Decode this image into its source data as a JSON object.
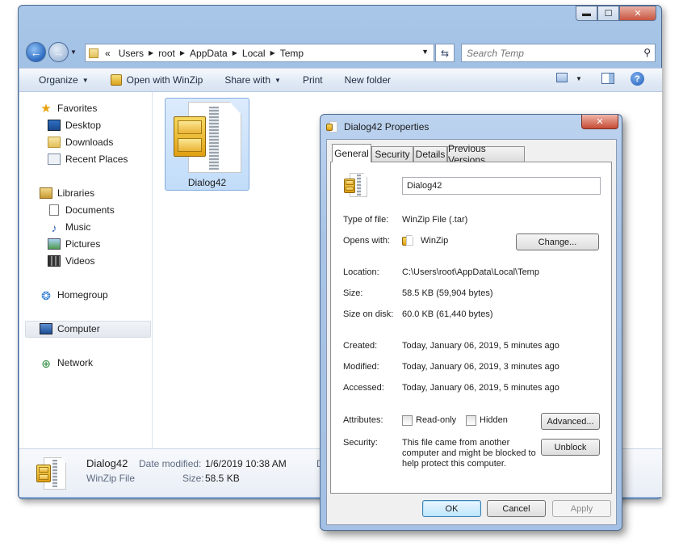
{
  "explorer": {
    "breadcrumb": {
      "overflow": "«",
      "parts": [
        "Users",
        "root",
        "AppData",
        "Local",
        "Temp"
      ]
    },
    "search_placeholder": "Search Temp",
    "toolbar": {
      "organize": "Organize",
      "open_with": "Open with WinZip",
      "share_with": "Share with",
      "print": "Print",
      "new_folder": "New folder"
    },
    "nav": {
      "favorites": "Favorites",
      "desktop": "Desktop",
      "downloads": "Downloads",
      "recent_places": "Recent Places",
      "libraries": "Libraries",
      "documents": "Documents",
      "music": "Music",
      "pictures": "Pictures",
      "videos": "Videos",
      "homegroup": "Homegroup",
      "computer": "Computer",
      "network": "Network"
    },
    "file": {
      "name": "Dialog42"
    },
    "details": {
      "name": "Dialog42",
      "type": "WinZip File",
      "date_modified_label": "Date modified:",
      "date_modified": "1/6/2019 10:38 AM",
      "size_label": "Size:",
      "size": "58.5 KB",
      "clipped_char": "D"
    }
  },
  "dialog": {
    "title": "Dialog42 Properties",
    "tabs": [
      "General",
      "Security",
      "Details",
      "Previous Versions"
    ],
    "active_tab": "General",
    "file_name": "Dialog42",
    "type_of_file_label": "Type of file:",
    "type_of_file": "WinZip File (.tar)",
    "opens_with_label": "Opens with:",
    "opens_with": "WinZip",
    "change_button": "Change...",
    "location_label": "Location:",
    "location": "C:\\Users\\root\\AppData\\Local\\Temp",
    "size_label": "Size:",
    "size": "58.5 KB (59,904 bytes)",
    "size_on_disk_label": "Size on disk:",
    "size_on_disk": "60.0 KB (61,440 bytes)",
    "created_label": "Created:",
    "created": "Today, January 06, 2019, 5 minutes ago",
    "modified_label": "Modified:",
    "modified": "Today, January 06, 2019, 3 minutes ago",
    "accessed_label": "Accessed:",
    "accessed": "Today, January 06, 2019, 5 minutes ago",
    "attributes_label": "Attributes:",
    "read_only_label": "Read-only",
    "read_only_checked": false,
    "hidden_label": "Hidden",
    "hidden_checked": false,
    "advanced_button": "Advanced...",
    "security_label": "Security:",
    "security_text_lines": [
      "This file came from another",
      "computer and might be blocked to",
      "help protect this computer."
    ],
    "unblock_button": "Unblock",
    "ok_button": "OK",
    "cancel_button": "Cancel",
    "apply_button": "Apply"
  },
  "colors": {
    "frame": "#a9c7e8",
    "selection": "#c1dcfa",
    "close_button": "#c8553f"
  }
}
